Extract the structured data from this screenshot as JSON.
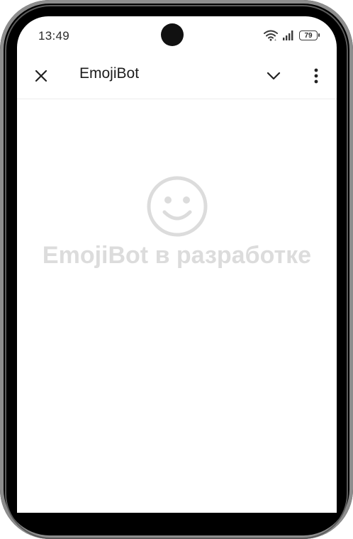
{
  "status_bar": {
    "time": "13:49",
    "battery": "79"
  },
  "app_bar": {
    "title": "EmojiBot"
  },
  "content": {
    "placeholder_text": "EmojiBot в разработке"
  },
  "icons": [
    "close-icon",
    "chevron-down-icon",
    "more-vert-icon",
    "wifi-icon",
    "signal-icon",
    "battery-icon",
    "smiley-icon"
  ]
}
